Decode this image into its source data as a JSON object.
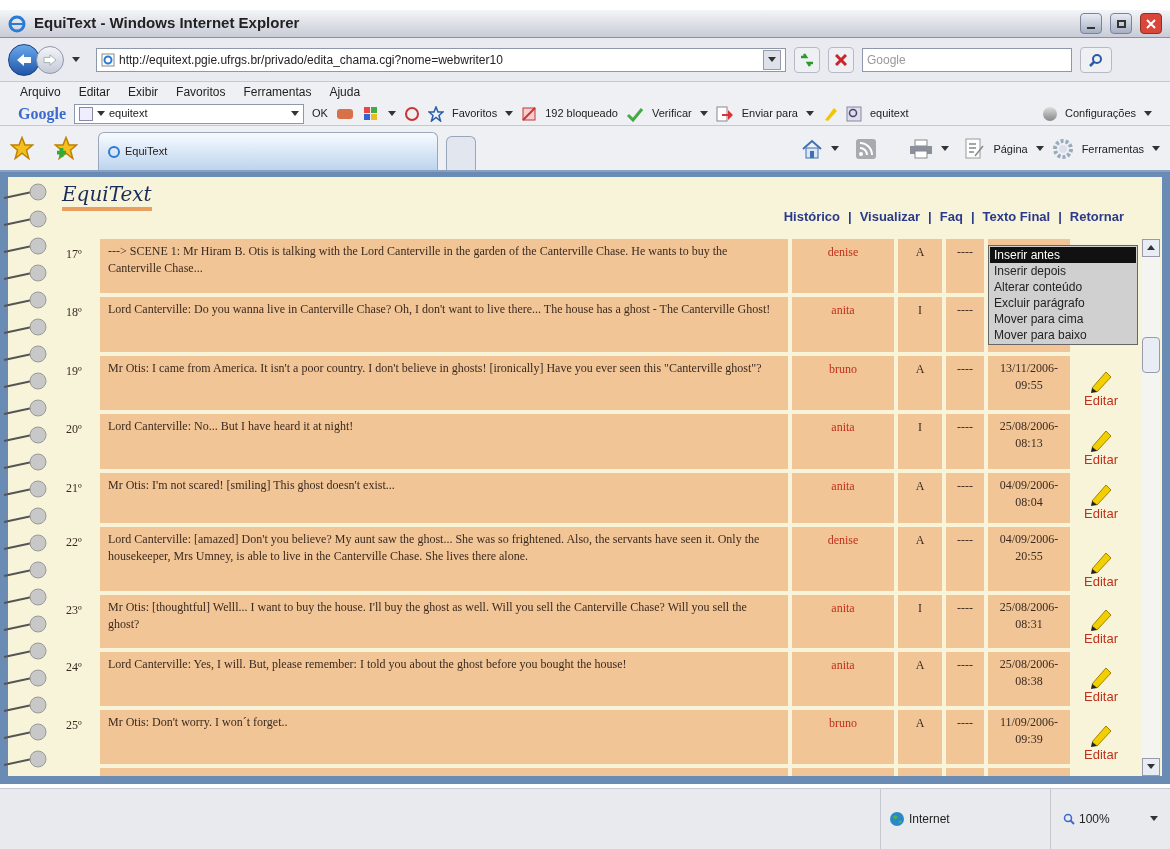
{
  "window": {
    "title": "EquiText - Windows Internet Explorer"
  },
  "address_bar": {
    "url": "http://equitext.pgie.ufrgs.br/privado/edita_chama.cgi?nome=webwriter10"
  },
  "search": {
    "placeholder": "Google"
  },
  "menu": [
    "Arquivo",
    "Editar",
    "Exibir",
    "Favoritos",
    "Ferramentas",
    "Ajuda"
  ],
  "google_toolbar": {
    "logo": "Google",
    "query": "equitext",
    "ok": "OK",
    "favorites": "Favoritos",
    "blocked": "192 bloqueado",
    "check": "Verificar",
    "send": "Enviar para",
    "bookmark": "equitext",
    "settings": "Configurações"
  },
  "tabs": [
    {
      "label": "EquiText",
      "selected": true
    }
  ],
  "command_bar": {
    "page": "Página",
    "tools": "Ferramentas"
  },
  "page": {
    "logo": "EquiText",
    "nav": [
      {
        "label": "Histórico"
      },
      {
        "separator": "|",
        "label": "Visualizar"
      },
      {
        "separator": "|",
        "label": "Faq"
      },
      {
        "separator": "|",
        "label": "Texto Final"
      },
      {
        "separator": "|",
        "label": "Retornar"
      }
    ],
    "rows": [
      {
        "number": "17º",
        "text": "---> SCENE 1: Mr Hiram B. Otis is talking with the Lord Canterville in the garden of the Canterville Chase. He wants to buy the Canterville Chase...",
        "author": "denise",
        "type": "A",
        "status": "----"
      },
      {
        "number": "18º",
        "text": "Lord Canterville: Do you wanna live in Canterville Chase? Oh, I don't want to live there... The house has a ghost - The Canterville Ghost!",
        "author": "anita",
        "type": "I",
        "status": "----"
      },
      {
        "number": "19º",
        "text": "Mr Otis: I came from America. It isn't a poor country. I don't believe in ghosts! [ironically] Have you ever seen this \"Canterville ghost\"?",
        "author": "bruno",
        "type": "A",
        "status": "----",
        "date": "13/11/2006-09:55",
        "edit": "Editar"
      },
      {
        "number": "20º",
        "text": "Lord Canterville: No... But I have heard it at night!",
        "author": "anita",
        "type": "I",
        "status": "----",
        "date": "25/08/2006-08:13",
        "edit": "Editar"
      },
      {
        "number": "21º",
        "text": "Mr Otis: I'm not scared! [smiling] This ghost doesn't exist...",
        "author": "anita",
        "type": "A",
        "status": "----",
        "date": "04/09/2006-08:04",
        "edit": "Editar"
      },
      {
        "number": "22º",
        "text": "Lord Canterville: [amazed] Don't you believe? My aunt saw the ghost... She was so frightened. Also, the servants have seen it. Only the housekeeper, Mrs Umney, is able to live in the Canterville Chase. She lives there alone.",
        "author": "denise",
        "type": "A",
        "status": "----",
        "date": "04/09/2006-20:55",
        "edit": "Editar"
      },
      {
        "number": "23º",
        "text": "Mr Otis: [thoughtful] Welll... I want to buy the house. I'll buy the ghost as well. Will you sell the Canterville Chase? Will you sell the ghost?",
        "author": "anita",
        "type": "I",
        "status": "----",
        "date": "25/08/2006-08:31",
        "edit": "Editar"
      },
      {
        "number": "24º",
        "text": "Lord Canterville: Yes, I will. But, please remember: I told you about the ghost before you bought the house!",
        "author": "anita",
        "type": "A",
        "status": "----",
        "date": "25/08/2006-08:38",
        "edit": "Editar"
      },
      {
        "number": "25º",
        "text": "Mr Otis: Don't worry. I won´t forget..",
        "author": "bruno",
        "type": "A",
        "status": "----",
        "date": "11/09/2006-09:39",
        "edit": "Editar"
      }
    ],
    "context_menu": [
      {
        "label": "Inserir antes",
        "selected": true
      },
      {
        "label": "Inserir depois",
        "selected": false
      },
      {
        "label": "Alterar conteúdo",
        "selected": false
      },
      {
        "label": "Excluir parágrafo",
        "selected": false
      },
      {
        "label": "Mover para cima",
        "selected": false
      },
      {
        "label": "Mover para baixo",
        "selected": false
      }
    ]
  },
  "status_bar": {
    "zone": "Internet",
    "zoom": "100%"
  }
}
